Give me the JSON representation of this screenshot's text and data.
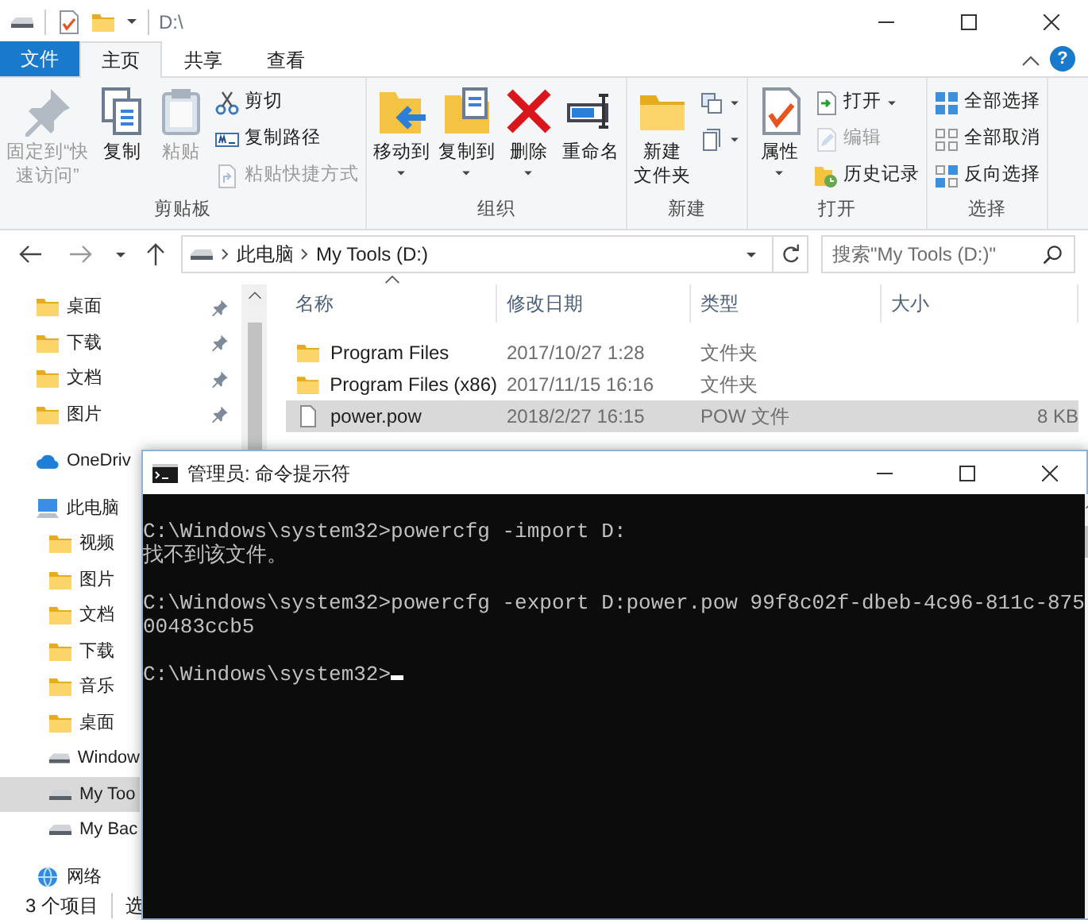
{
  "explorer": {
    "title": "D:\\",
    "tabs": [
      {
        "label": "文件",
        "kind": "menu",
        "selected": false
      },
      {
        "label": "主页",
        "kind": "tab",
        "selected": true
      },
      {
        "label": "共享",
        "kind": "tab",
        "selected": false
      },
      {
        "label": "查看",
        "kind": "tab",
        "selected": false
      }
    ],
    "help_label": "?",
    "ribbon": [
      {
        "label": "剪贴板",
        "items": [
          {
            "kind": "large",
            "lines": [
              "固定到“快",
              "速访问”"
            ],
            "disabled": true,
            "dropdown": false
          },
          {
            "kind": "large",
            "label": "复制",
            "disabled": false,
            "dropdown": false
          },
          {
            "kind": "large",
            "label": "粘贴",
            "disabled": true,
            "dropdown": false
          },
          {
            "kind": "small",
            "label": "剪切",
            "disabled": false,
            "dropdown": false
          },
          {
            "kind": "small",
            "label": "复制路径",
            "disabled": false,
            "dropdown": false
          },
          {
            "kind": "small",
            "label": "粘贴快捷方式",
            "disabled": true,
            "dropdown": false
          }
        ]
      },
      {
        "label": "组织",
        "items": [
          {
            "kind": "large",
            "label": "移动到",
            "disabled": false,
            "dropdown": true
          },
          {
            "kind": "large",
            "label": "复制到",
            "disabled": false,
            "dropdown": true
          },
          {
            "kind": "large",
            "label": "删除",
            "disabled": false,
            "dropdown": true
          },
          {
            "kind": "large",
            "label": "重命名",
            "disabled": false,
            "dropdown": false
          }
        ]
      },
      {
        "label": "新建",
        "items": [
          {
            "kind": "large",
            "lines": [
              "新建",
              "文件夹"
            ],
            "disabled": false,
            "dropdown": false
          },
          {
            "kind": "small",
            "disabled": false,
            "dropdown": true
          },
          {
            "kind": "small",
            "disabled": false,
            "dropdown": true
          }
        ]
      },
      {
        "label": "打开",
        "items": [
          {
            "kind": "large",
            "label": "属性",
            "disabled": false,
            "dropdown": true
          },
          {
            "kind": "small",
            "label": "打开",
            "disabled": false,
            "dropdown": true
          },
          {
            "kind": "small",
            "label": "编辑",
            "disabled": true,
            "dropdown": false
          },
          {
            "kind": "small",
            "label": "历史记录",
            "disabled": false,
            "dropdown": false
          }
        ]
      },
      {
        "label": "选择",
        "items": [
          {
            "kind": "small",
            "label": "全部选择",
            "disabled": false,
            "dropdown": false
          },
          {
            "kind": "small",
            "label": "全部取消",
            "disabled": false,
            "dropdown": false
          },
          {
            "kind": "small",
            "label": "反向选择",
            "disabled": false,
            "dropdown": false
          }
        ]
      }
    ],
    "back": {
      "disabled": false
    },
    "forward": {
      "disabled": true
    },
    "address": {
      "crumbs": [
        "此电脑",
        "My Tools (D:)"
      ]
    },
    "search": {
      "placeholder": "搜索\"My Tools (D:)\""
    },
    "sidebar": {
      "sections": [
        {
          "items": [
            {
              "kind": "folder",
              "label": "桌面",
              "pinned": true,
              "selected": false
            },
            {
              "kind": "folder",
              "label": "下载",
              "pinned": true,
              "selected": false
            },
            {
              "kind": "folder",
              "label": "文档",
              "pinned": true,
              "selected": false
            },
            {
              "kind": "folder",
              "label": "图片",
              "pinned": true,
              "selected": false
            }
          ]
        },
        {
          "items": [
            {
              "kind": "cloud",
              "label": "OneDriv",
              "selected": false
            }
          ]
        },
        {
          "items": [
            {
              "kind": "computer",
              "label": "此电脑",
              "selected": false,
              "children": [
                {
                  "kind": "folder",
                  "label": "视频",
                  "selected": false
                },
                {
                  "kind": "folder",
                  "label": "图片",
                  "selected": false
                },
                {
                  "kind": "folder",
                  "label": "文档",
                  "selected": false
                },
                {
                  "kind": "folder",
                  "label": "下载",
                  "selected": false
                },
                {
                  "kind": "folder",
                  "label": "音乐",
                  "selected": false
                },
                {
                  "kind": "folder",
                  "label": "桌面",
                  "selected": false
                },
                {
                  "kind": "drive",
                  "label": "Window",
                  "selected": false
                },
                {
                  "kind": "drive",
                  "label": "My Too",
                  "selected": true
                },
                {
                  "kind": "drive",
                  "label": "My Bac",
                  "selected": false
                }
              ]
            }
          ]
        },
        {
          "items": [
            {
              "kind": "network",
              "label": "网络",
              "selected": false
            }
          ]
        }
      ]
    },
    "columns": [
      {
        "label": "名称",
        "sorted": true
      },
      {
        "label": "修改日期",
        "sorted": false
      },
      {
        "label": "类型",
        "sorted": false
      },
      {
        "label": "大小",
        "sorted": false
      }
    ],
    "rows": [
      {
        "kind": "folder",
        "name": "Program Files",
        "date": "2017/10/27 1:28",
        "type": "文件夹",
        "selected": false
      },
      {
        "kind": "folder",
        "name": "Program Files (x86)",
        "date": "2017/11/15 16:16",
        "type": "文件夹",
        "selected": false
      },
      {
        "kind": "file",
        "name": "power.pow",
        "date": "2018/2/27 16:15",
        "type": "POW 文件",
        "size": "8 KB",
        "selected": true
      }
    ],
    "status": {
      "count": "3 个项目",
      "selection": "选"
    }
  },
  "console": {
    "title": "管理员: 命令提示符",
    "blocks": [
      [
        "C:\\Windows\\system32>powercfg -import D:",
        "找不到该文件。"
      ],
      [
        "C:\\Windows\\system32>powercfg -export D:power.pow 99f8c02f-dbeb-4c96-811c-875",
        "00483ccb5"
      ],
      [
        "C:\\Windows\\system32>"
      ]
    ],
    "cursor": true
  }
}
